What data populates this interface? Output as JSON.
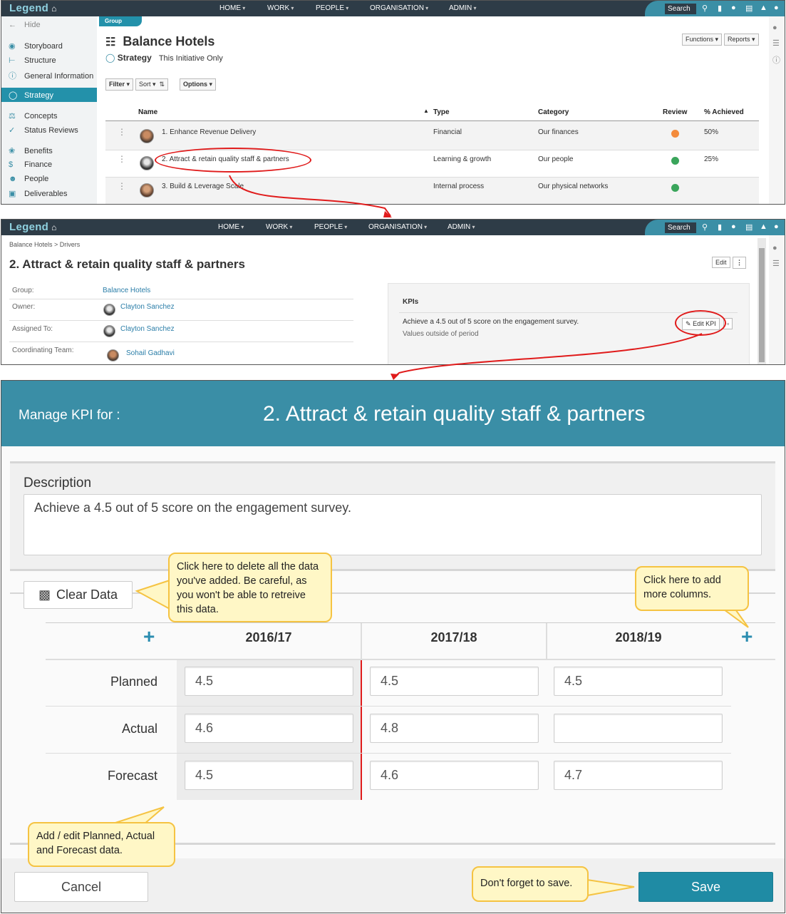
{
  "brand": {
    "logo": "Legend",
    "accent": "#2391aa",
    "nav_bg": "#2e3c47"
  },
  "topnav": {
    "items": [
      "HOME",
      "WORK",
      "PEOPLE",
      "ORGANISATION",
      "ADMIN"
    ],
    "search_label": "Search"
  },
  "panel1": {
    "sidebar": {
      "hide": "Hide",
      "items": [
        "Storyboard",
        "Structure",
        "General Information",
        "Strategy",
        "Concepts",
        "Status Reviews",
        "Benefits",
        "Finance",
        "People",
        "Deliverables"
      ],
      "active": "Strategy"
    },
    "group_badge": "Group",
    "title": "Balance Hotels",
    "subtitle_label": "Strategy",
    "subtitle_scope": "This Initiative Only",
    "toolbar": {
      "filter": "Filter",
      "sort": "Sort",
      "options": "Options",
      "functions": "Functions",
      "reports": "Reports"
    },
    "table": {
      "headers": [
        "Name",
        "Type",
        "Category",
        "Review",
        "% Achieved"
      ],
      "rows": [
        {
          "name": "1. Enhance Revenue Delivery",
          "type": "Financial",
          "category": "Our finances",
          "review": "orange",
          "achieved": "50%"
        },
        {
          "name": "2. Attract & retain quality staff & partners",
          "type": "Learning & growth",
          "category": "Our people",
          "review": "green",
          "achieved": "25%"
        },
        {
          "name": "3. Build & Leverage Scale",
          "type": "Internal process",
          "category": "Our physical networks",
          "review": "green",
          "achieved": ""
        }
      ]
    }
  },
  "panel2": {
    "breadcrumb": "Balance Hotels > Drivers",
    "title": "2. Attract & retain quality staff & partners",
    "edit": "Edit",
    "fields": [
      {
        "label": "Group:",
        "value": "Balance Hotels"
      },
      {
        "label": "Owner:",
        "value": "Clayton Sanchez"
      },
      {
        "label": "Assigned To:",
        "value": "Clayton Sanchez"
      },
      {
        "label": "Coordinating Team:",
        "value": "Sohail Gadhavi"
      }
    ],
    "kpis": {
      "heading": "KPIs",
      "text": "Achieve a 4.5 out of 5 score on the engagement survey.",
      "subtext": "Values outside of period",
      "edit_kpi": "Edit KPI"
    }
  },
  "panel3": {
    "header_prefix": "Manage KPI for :",
    "header_title": "2. Attract & retain quality staff & partners",
    "description_label": "Description",
    "description_value": "Achieve a 4.5 out of 5 score on the engagement survey.",
    "clear_data": "Clear Data",
    "columns": [
      "2016/17",
      "2017/18",
      "2018/19"
    ],
    "rows": [
      {
        "label": "Planned",
        "values": [
          "4.5",
          "4.5",
          "4.5"
        ]
      },
      {
        "label": "Actual",
        "values": [
          "4.6",
          "4.8",
          ""
        ]
      },
      {
        "label": "Forecast",
        "values": [
          "4.5",
          "4.6",
          "4.7"
        ]
      }
    ],
    "cancel": "Cancel",
    "save": "Save",
    "callouts": {
      "clear": "Click here to delete all the data you've added. Be careful, as you won't be able to retreive this data.",
      "columns": "Click here to add more columns.",
      "edit": "Add / edit  Planned, Actual and Forecast data.",
      "save": "Don't forget to save."
    }
  }
}
